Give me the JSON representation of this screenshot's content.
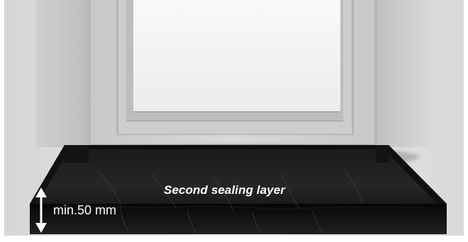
{
  "labels": {
    "sealing_layer": "Second sealing layer",
    "min_height": "min.50 mm"
  },
  "colors": {
    "wall": "#dedede",
    "window_frame": "#cbcbcb",
    "glass": "#f2f2f2",
    "membrane": "#111111",
    "text": "#ffffff"
  }
}
